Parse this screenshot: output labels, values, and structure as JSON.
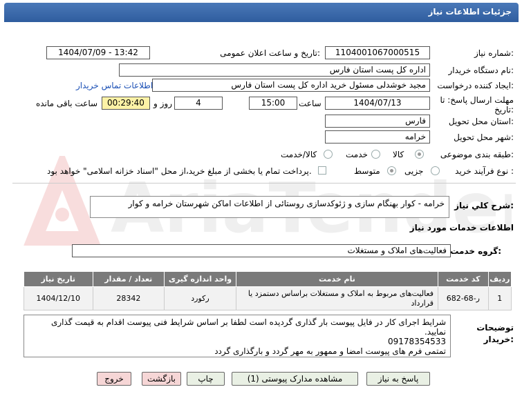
{
  "header": {
    "title": "جزئيات اطلاعات نياز"
  },
  "watermark": {
    "text": "AriaTender.net"
  },
  "fields": {
    "need_number_label": "شماره نياز:",
    "need_number": "1104001067000515",
    "announce_label": "تاريخ و ساعت اعلان عمومی:",
    "announce_value": "1404/07/09 - 13:42",
    "buyer_label": "نام دستگاه خريدار:",
    "buyer_value": "اداره کل پست استان فارس",
    "creator_label": "ايجاد کننده درخواست:",
    "creator_value": "مجید خوشدلی مسئول خرید اداره کل پست استان فارس",
    "contact_link": "اطلاعات تماس خريدار",
    "deadline_label": "مهلت ارسال پاسخ: تا تاريخ:",
    "deadline_date": "1404/07/13",
    "time_label": "ساعت",
    "deadline_time": "15:00",
    "days_value": "4",
    "days_label": "روز و",
    "remaining_time": "00:29:40",
    "remaining_label": "ساعت باقی مانده",
    "province_label": "استان محل تحويل:",
    "province_value": "فارس",
    "city_label": "شهر محل تحويل:",
    "city_value": "خرامه",
    "category_label": "طبقه بندی موضوعی:",
    "category_options": [
      "کالا",
      "خدمت",
      "کالا/خدمت"
    ],
    "process_label": "نوع فرآيند خريد :",
    "process_options": [
      "جزيی",
      "متوسط"
    ],
    "payment_note": "پرداخت تمام يا بخشی از مبلغ خريد،از محل \"اسناد خزانه اسلامی\" خواهد بود."
  },
  "summary": {
    "label": "شرح كلي نياز:",
    "value": "خرامه - کوار بهنگام سازی و ژئوکدسازی روستائی از اطلاعات اماکن شهرستان خرامه و کوار"
  },
  "services": {
    "section_title": "اطلاعات خدمات مورد نياز",
    "group_label": "گروه خدمت:",
    "group_value": "فعاليت‌های  املاک و مستغلات",
    "columns": [
      "رديف",
      "کد خدمت",
      "نام خدمت",
      "واحد اندازه گيری",
      "تعداد / مقدار",
      "تاريخ نياز"
    ],
    "rows": [
      [
        "1",
        "ر-68-682",
        "فعالیت‌های مربوط به املاک و مستغلات براساس دستمزد یا قرارداد",
        "رکورد",
        "28342",
        "1404/12/10"
      ]
    ]
  },
  "notes": {
    "label": "توضيحات خريدار:",
    "lines": [
      "شرایط اجرای کار در فایل پیوست بار گذاری گردیده است لطفا بر اساس شرایط فنی پیوست اقدام به قیمت گذاری نمایید.",
      "09178354533",
      "تمتمی فرم های پیوست امضا و ممهور به مهر گردد و بارگذاری گردد"
    ]
  },
  "buttons": {
    "respond": "پاسخ به نياز",
    "attachments": "مشاهده مدارک پيوستی (1)",
    "print": "چاپ",
    "back": "بازگشت",
    "exit": "خروج"
  }
}
